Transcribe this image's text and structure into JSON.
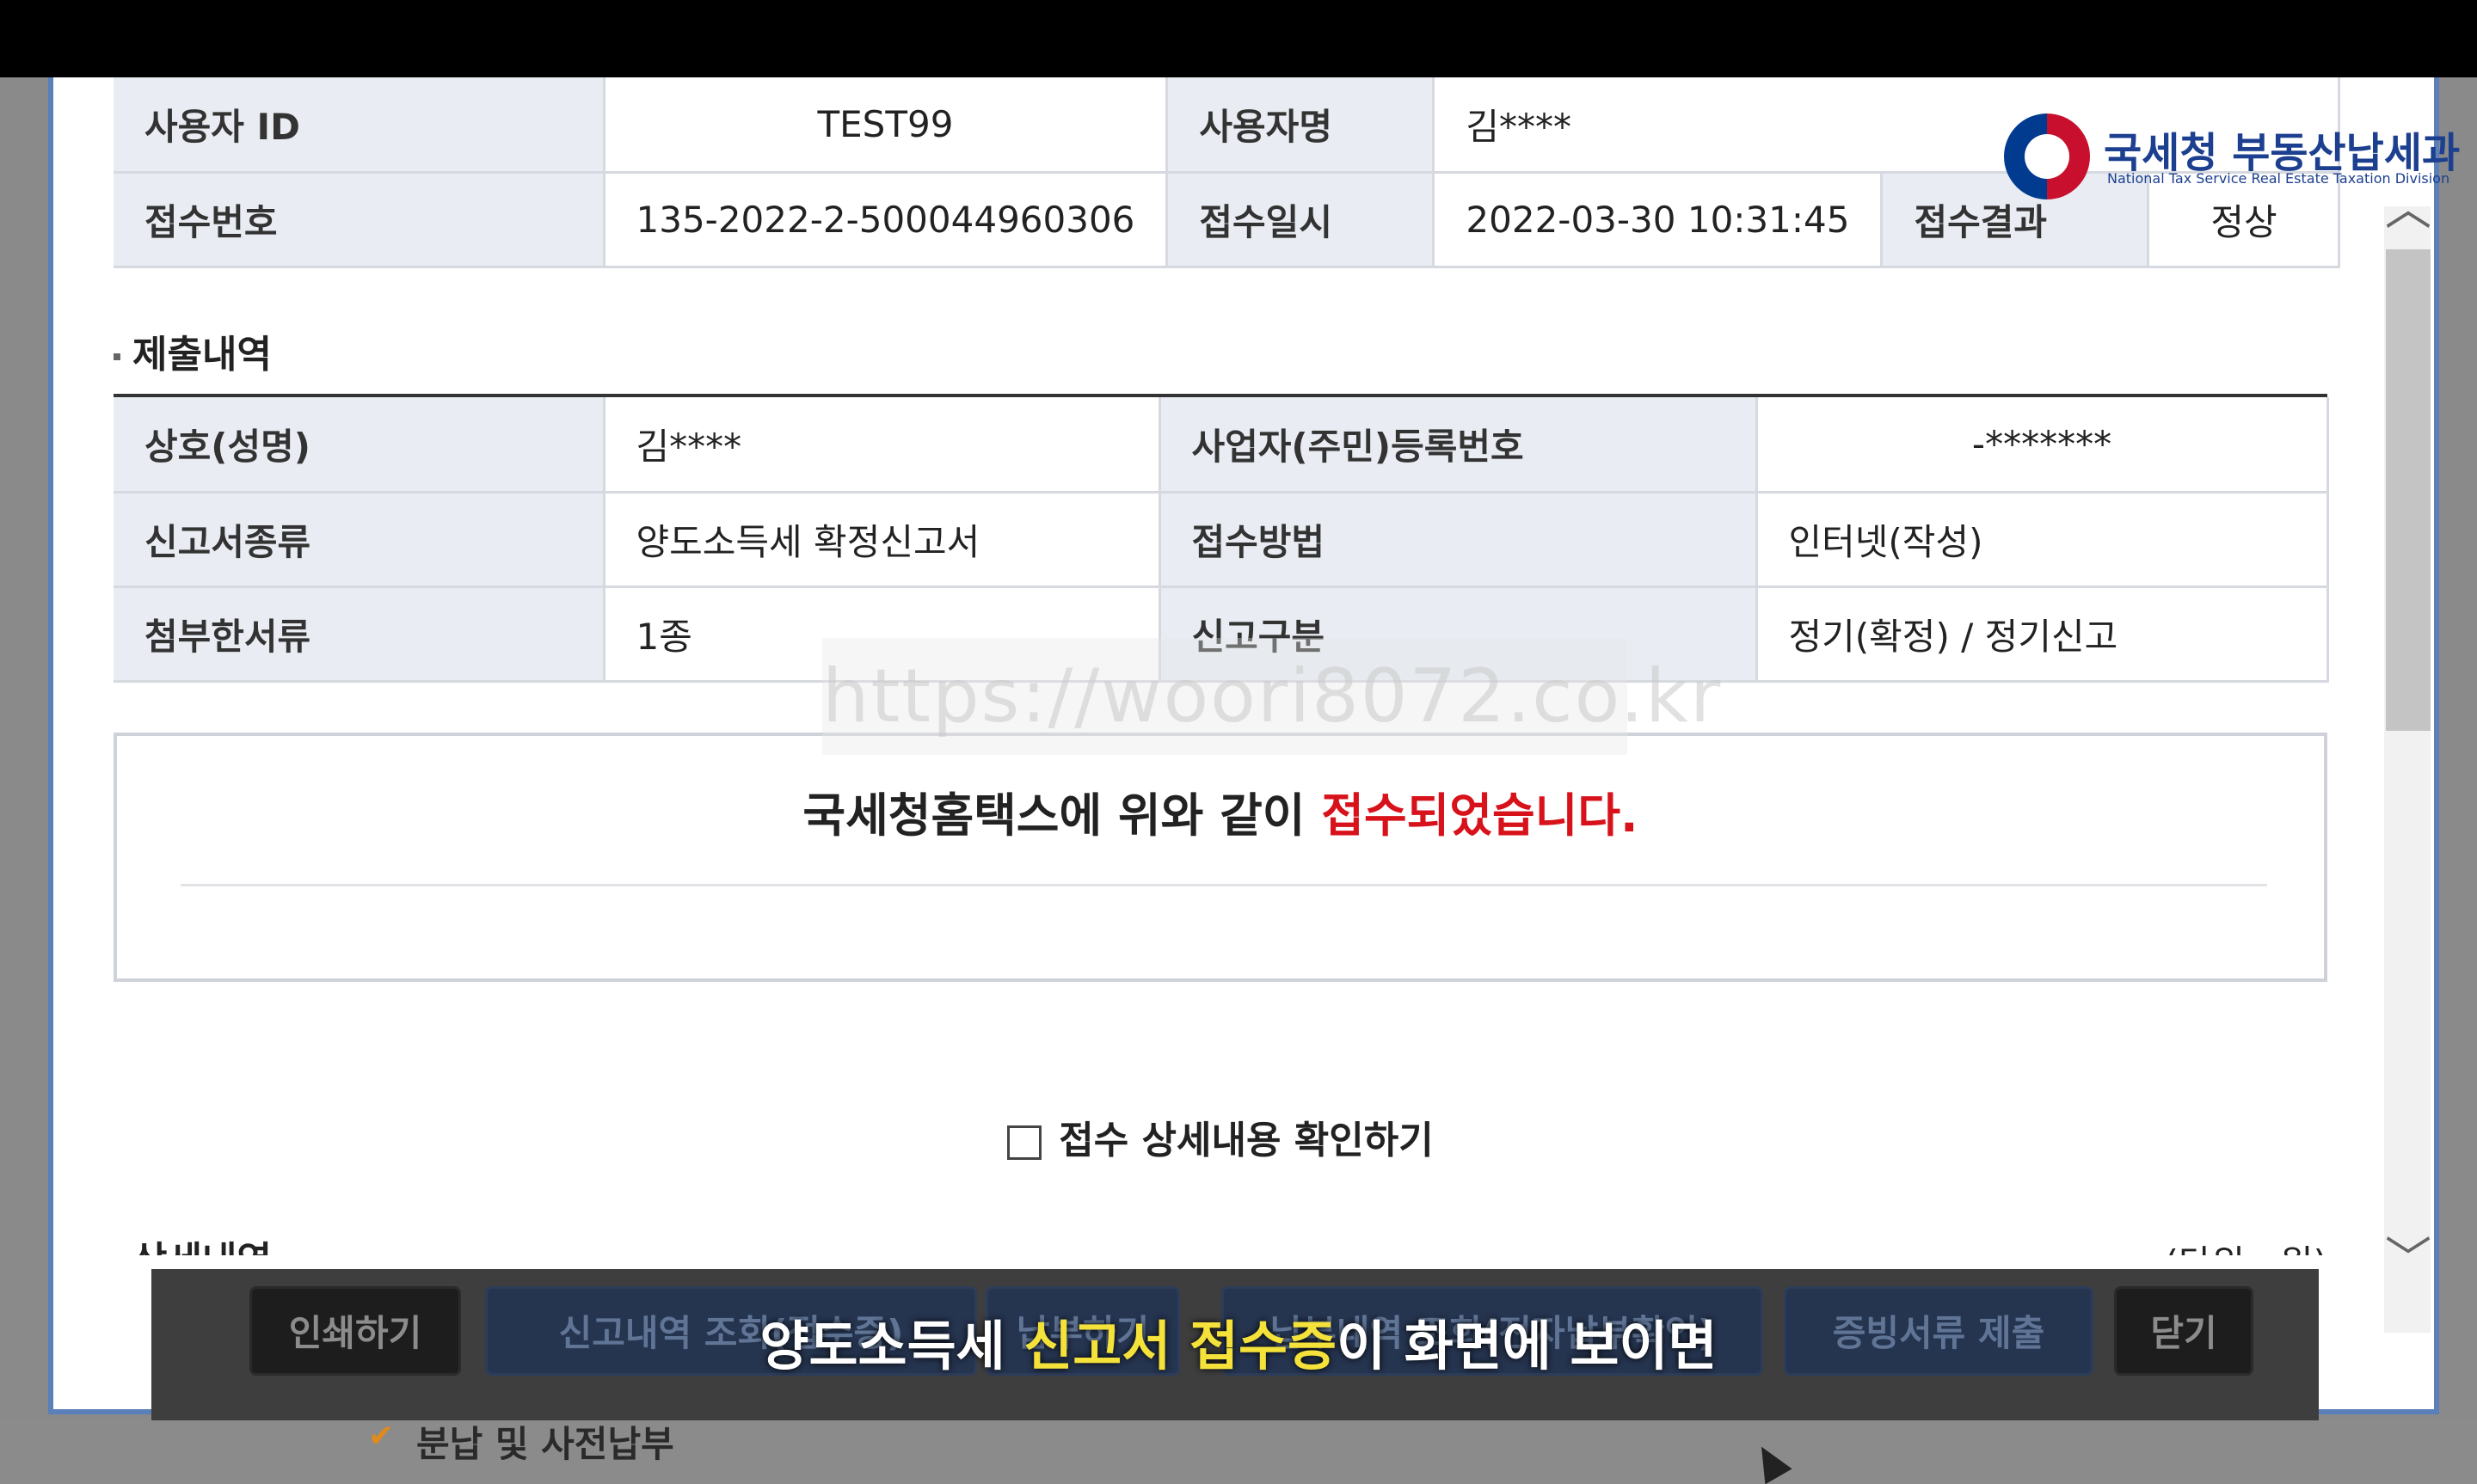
{
  "header_rows": [
    {
      "label1": "사용자 ID",
      "value1": "TEST99",
      "label2": "사용자명",
      "value2": "김****"
    },
    {
      "label1": "접수번호",
      "value1": "135-2022-2-500044960306",
      "label2": "접수일시",
      "value2": "2022-03-30 10:31:45",
      "label3": "접수결과",
      "value3": "정상"
    }
  ],
  "submission": {
    "title": "제출내역",
    "rows": [
      {
        "label1": "상호(성명)",
        "value1": "김****",
        "label2": "사업자(주민)등록번호",
        "value2": "-*******"
      },
      {
        "label1": "신고서종류",
        "value1": "양도소득세 확정신고서",
        "label2": "접수방법",
        "value2": "인터넷(작성)"
      },
      {
        "label1": "첨부한서류",
        "value1": "1종",
        "label2": "신고구분",
        "value2": "정기(확정) / 정기신고"
      }
    ]
  },
  "notice": {
    "prefix": "국세청홈택스에 위와 같이 ",
    "highlight": "접수되었습니다."
  },
  "detail_check": {
    "label": "접수 상세내용 확인하기"
  },
  "detail": {
    "title": "상세내역",
    "unit": "(단위 : 원)"
  },
  "logo": {
    "name": "국세청 부동산납세과",
    "sub": "National Tax Service Real Estate Taxation Division"
  },
  "watermark": "https://woori8072.co.kr",
  "buttons": {
    "print": "인쇄하기",
    "history": "신고내역 조회(접수증)",
    "pay": "납부하기",
    "payment_inquiry": "납부내역 조회(전자납부확인)",
    "evidence": "증빙서류 제출",
    "close": "닫기"
  },
  "caption": {
    "prefix": "양도소득세 ",
    "highlight": "신고서 접수증",
    "suffix": "이 화면에 보이면"
  },
  "bottom_text": "분납 및 사전납부",
  "colors": {
    "accent_red": "#d8121b",
    "label_bg": "#e9edf3",
    "caption_highlight": "#f4e23b"
  }
}
